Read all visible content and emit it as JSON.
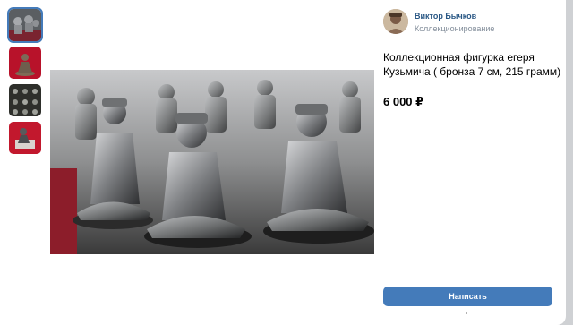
{
  "seller": {
    "name": "Виктор Бычков",
    "subtitle": "Коллекционирование"
  },
  "product": {
    "title": "Коллекционная фигурка егеря Кузьмича ( бронза 7 см, 215 грамм)",
    "price": "6 000 ₽"
  },
  "actions": {
    "write_label": "Написать"
  },
  "thumbnails": [
    {
      "name": "thumbnail-1",
      "active": true
    },
    {
      "name": "thumbnail-2",
      "active": false
    },
    {
      "name": "thumbnail-3",
      "active": false
    },
    {
      "name": "thumbnail-4",
      "active": false
    }
  ],
  "colors": {
    "accent": "#447bba",
    "link": "#2a5885",
    "muted": "#818c99"
  }
}
